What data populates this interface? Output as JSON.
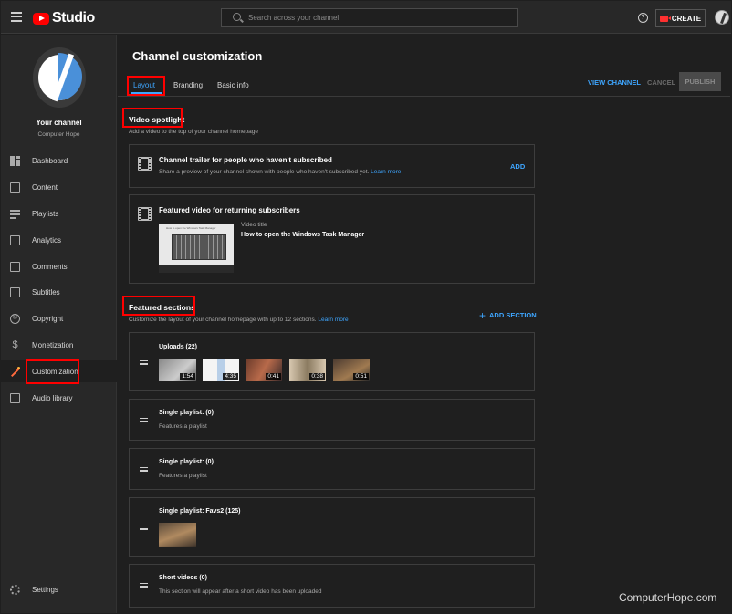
{
  "topbar": {
    "logo_text": "Studio",
    "search_placeholder": "Search across your channel",
    "help_glyph": "?",
    "create_label": "CREATE"
  },
  "sidebar": {
    "channel_title": "Your channel",
    "channel_name": "Computer Hope",
    "items": [
      {
        "label": "Dashboard",
        "icon": "dashboard-icon"
      },
      {
        "label": "Content",
        "icon": "content-icon"
      },
      {
        "label": "Playlists",
        "icon": "playlists-icon"
      },
      {
        "label": "Analytics",
        "icon": "analytics-icon"
      },
      {
        "label": "Comments",
        "icon": "comments-icon"
      },
      {
        "label": "Subtitles",
        "icon": "subtitles-icon"
      },
      {
        "label": "Copyright",
        "icon": "copyright-icon"
      },
      {
        "label": "Monetization",
        "icon": "monetization-icon"
      },
      {
        "label": "Customization",
        "icon": "customization-icon",
        "active": true
      },
      {
        "label": "Audio library",
        "icon": "audio-library-icon"
      }
    ],
    "settings_label": "Settings",
    "copyright_glyph": "©",
    "dollar_glyph": "$"
  },
  "main": {
    "title": "Channel customization",
    "tabs": [
      {
        "label": "Layout",
        "active": true
      },
      {
        "label": "Branding"
      },
      {
        "label": "Basic info"
      }
    ],
    "view_channel": "VIEW CHANNEL",
    "cancel": "CANCEL",
    "publish": "PUBLISH",
    "video_spotlight": {
      "title": "Video spotlight",
      "desc": "Add a video to the top of your channel homepage",
      "trailer": {
        "title": "Channel trailer for people who haven't subscribed",
        "desc": "Share a preview of your channel shown with people who haven't subscribed yet.",
        "learn_more": "Learn more",
        "action": "ADD"
      },
      "featured": {
        "title": "Featured video for returning subscribers",
        "video_title_label": "Video title",
        "video_title": "How to open the Windows Task Manager",
        "thumb_caption": "How to open the Windows Task Manager"
      }
    },
    "featured_sections": {
      "title": "Featured sections",
      "desc": "Customize the layout of your channel homepage with up to 12 sections.",
      "learn_more": "Learn more",
      "add_section": "ADD SECTION",
      "add_glyph": "+",
      "sections": [
        {
          "title": "Uploads (22)",
          "durations": [
            "1:54",
            "4:35",
            "0:41",
            "0:38",
            "0:51"
          ]
        },
        {
          "title": "Single playlist: (0)",
          "desc": "Features a playlist"
        },
        {
          "title": "Single playlist: (0)",
          "desc": "Features a playlist"
        },
        {
          "title": "Single playlist: Favs2 (125)"
        },
        {
          "title": "Short videos (0)",
          "desc": "This section will appear after a short video has been uploaded"
        }
      ]
    }
  },
  "watermark": "ComputerHope.com",
  "colors": {
    "accent": "#3ea6ff",
    "highlight": "#ff0000",
    "background": "#1f1f1f",
    "panel": "#282828"
  }
}
